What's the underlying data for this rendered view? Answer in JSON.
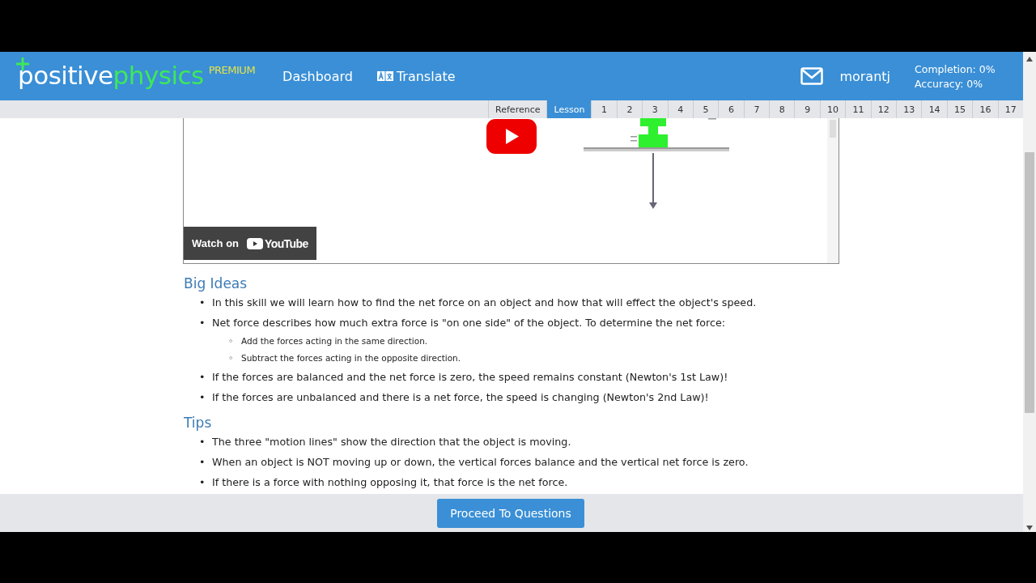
{
  "header": {
    "logo": {
      "part_1": "positive",
      "part_2": "physics",
      "badge": "PREMIUM"
    },
    "nav": [
      {
        "label": "Dashboard",
        "kind": "link"
      },
      {
        "label": "Translate",
        "kind": "translate"
      }
    ],
    "user": "morantj",
    "completion": "Completion: 0%",
    "accuracy": "Accuracy: 0%"
  },
  "tabs": [
    {
      "label": "Reference",
      "selected": false
    },
    {
      "label": "Lesson",
      "selected": true
    },
    {
      "label": "1",
      "selected": false
    },
    {
      "label": "2",
      "selected": false
    },
    {
      "label": "3",
      "selected": false
    },
    {
      "label": "4",
      "selected": false
    },
    {
      "label": "5",
      "selected": false
    },
    {
      "label": "6",
      "selected": false
    },
    {
      "label": "7",
      "selected": false
    },
    {
      "label": "8",
      "selected": false
    },
    {
      "label": "9",
      "selected": false
    },
    {
      "label": "10",
      "selected": false
    },
    {
      "label": "11",
      "selected": false
    },
    {
      "label": "12",
      "selected": false
    },
    {
      "label": "13",
      "selected": false
    },
    {
      "label": "14",
      "selected": false
    },
    {
      "label": "15",
      "selected": false
    },
    {
      "label": "16",
      "selected": false
    },
    {
      "label": "17",
      "selected": false
    }
  ],
  "video": {
    "kind": "picture",
    "watch_label": "Watch on",
    "brand": "YouTube"
  },
  "sections": [
    {
      "title": "Big Ideas",
      "items": [
        {
          "bullet": "•",
          "text": "In this skill we will learn how to find the net force on an object and how that will effect the object's speed."
        },
        {
          "bullet": "•",
          "text": "Net force describes how much extra force is \"on one side\" of the object. To determine the net force:",
          "children": [
            {
              "bullet": "◦",
              "text": "Add the forces acting in the same direction."
            },
            {
              "bullet": "◦",
              "text": "Subtract the forces acting in the opposite direction."
            }
          ]
        },
        {
          "bullet": "•",
          "text": "If the forces are balanced and the net force is zero, the speed remains constant (Newton's 1st Law)!"
        },
        {
          "bullet": "•",
          "text": "If the forces are unbalanced and there is a net force, the speed is changing (Newton's 2nd Law)!"
        }
      ]
    },
    {
      "title": "Tips",
      "items": [
        {
          "bullet": "•",
          "text": "The three \"motion lines\" show the direction that the object is moving."
        },
        {
          "bullet": "•",
          "text": "When an object is NOT moving up or down, the vertical forces balance and the vertical net force is zero."
        },
        {
          "bullet": "•",
          "text": "If there is a force with nothing opposing it, that force is the net force."
        }
      ]
    }
  ],
  "footer": {
    "button": "Proceed To Questions"
  }
}
